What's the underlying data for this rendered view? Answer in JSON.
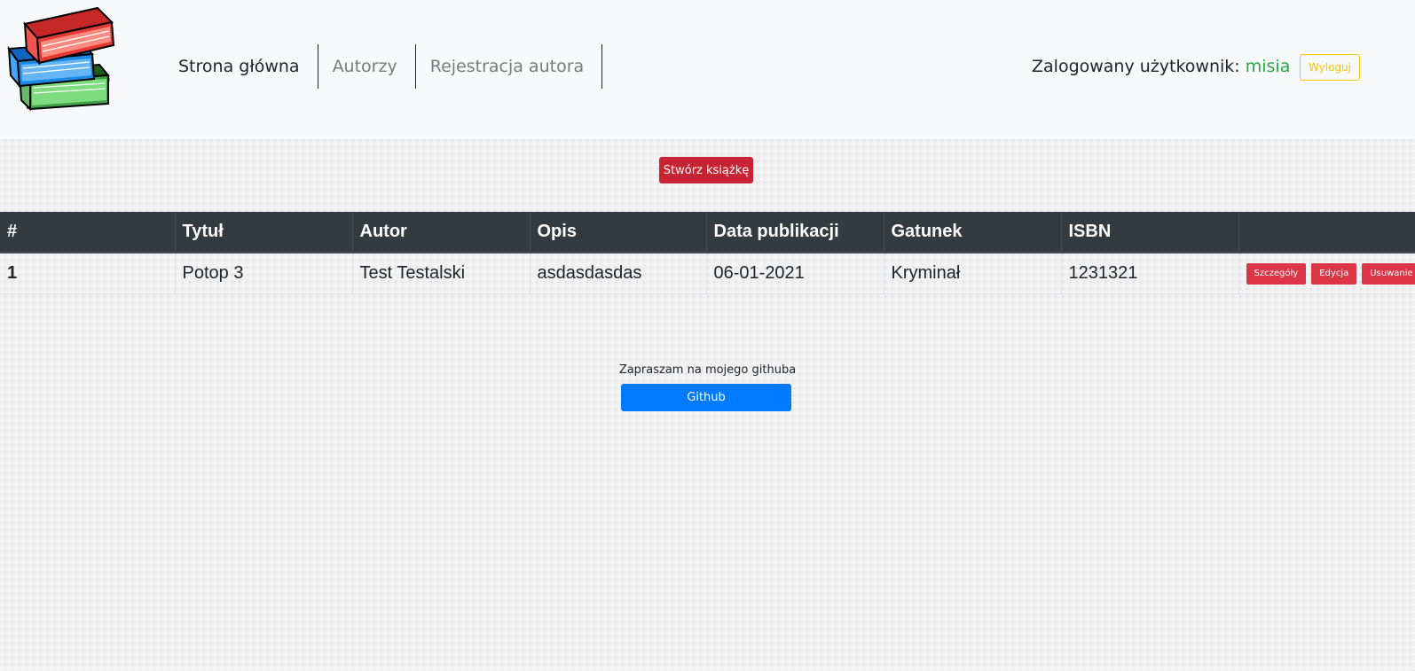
{
  "nav": {
    "logo": "books-logo",
    "links": [
      {
        "label": "Strona główna",
        "active": true
      },
      {
        "label": "Autorzy",
        "active": false
      },
      {
        "label": "Rejestracja autora",
        "active": false
      }
    ],
    "user_label": "Zalogowany użytkownik:",
    "user_name": "misia",
    "logout_label": "Wyloguj"
  },
  "actions": {
    "create_book_label": "Stwórz książkę"
  },
  "table": {
    "headers": [
      "#",
      "Tytuł",
      "Autor",
      "Opis",
      "Data publikacji",
      "Gatunek",
      "ISBN",
      ""
    ],
    "rows": [
      {
        "id": "1",
        "title": "Potop 3",
        "author": "Test Testalski",
        "description": "asdasdasdas",
        "publication_date": "06-01-2021",
        "genre": "Kryminał",
        "isbn": "1231321",
        "details_label": "Szczegóły",
        "edit_label": "Edycja",
        "delete_label": "Usuwanie"
      }
    ]
  },
  "footer": {
    "text": "Zapraszam na mojego githuba",
    "github_label": "Github"
  },
  "colors": {
    "navbar_bg": "#f8f9fa",
    "table_header_bg": "#343a40",
    "danger": "#dc3545",
    "create_button": "#c82333",
    "primary": "#007bff",
    "warning": "#ffc107",
    "username": "#28a745"
  }
}
